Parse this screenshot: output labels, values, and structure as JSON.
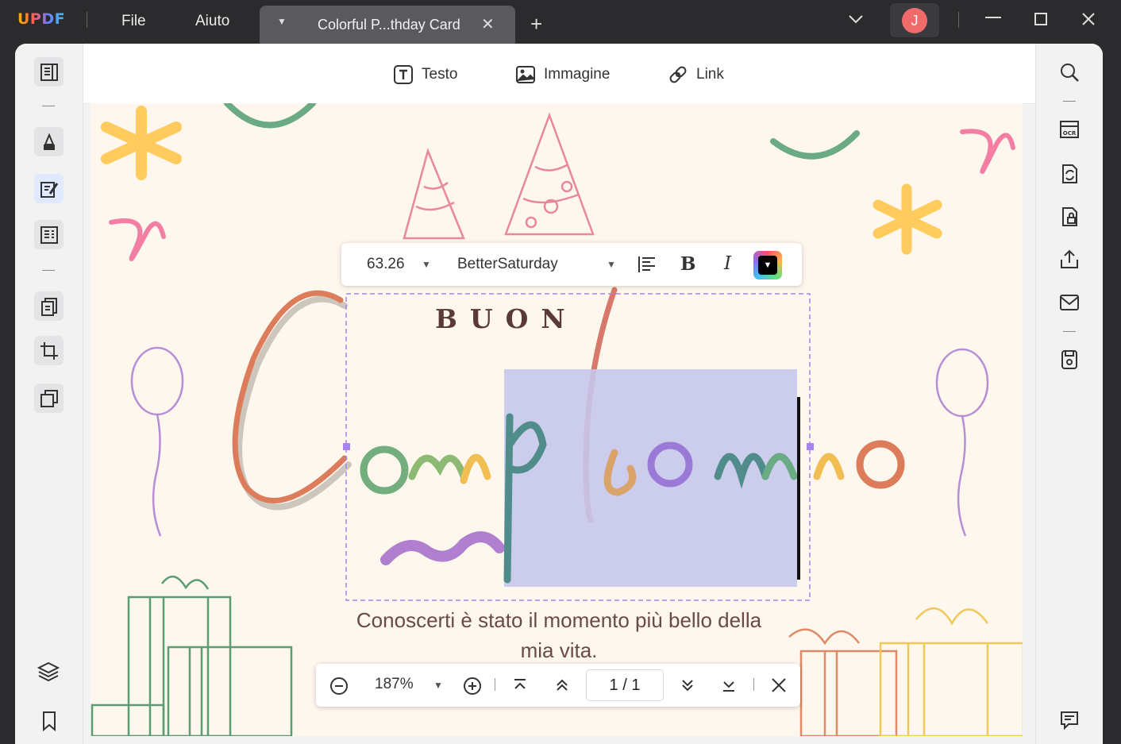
{
  "app": {
    "logo": "UPDF",
    "menu": [
      "File",
      "Aiuto"
    ],
    "tab_title": "Colorful P...thday Card",
    "avatar_initial": "J"
  },
  "toolbar": {
    "text": "Testo",
    "image": "Immagine",
    "link": "Link"
  },
  "format": {
    "font_size": "63.26",
    "font_name": "BetterSaturday",
    "bold": "B",
    "italic": "I"
  },
  "card": {
    "line1": "BUON",
    "line2": "Compleanno",
    "message": "Conoscerti è stato il momento più bello della mia vita."
  },
  "nav": {
    "zoom": "187%",
    "page": "1 / 1"
  },
  "colors": {
    "accent": "#8c6cf0",
    "avatar": "#f06a6a",
    "selection": "#c7c6ec"
  }
}
